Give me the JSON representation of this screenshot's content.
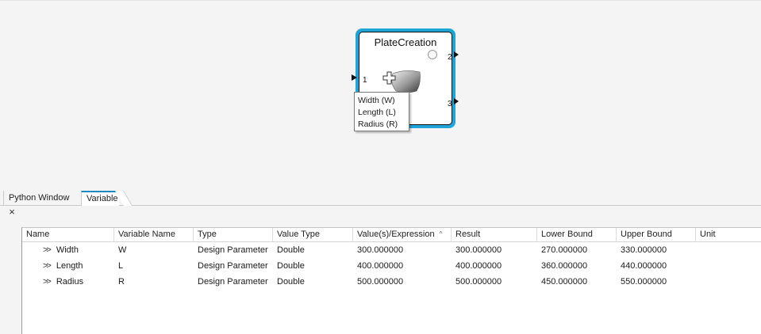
{
  "canvas": {
    "block": {
      "title": "PlateCreation",
      "input_port": "1",
      "output_port_top": "2",
      "output_port_bottom": "3",
      "accent_color": "#1fa4d8"
    },
    "tooltip": {
      "lines": [
        "Width (W)",
        "Length (L)",
        "Radius (R)"
      ]
    }
  },
  "tabs": [
    {
      "label": "Python Window",
      "active": false
    },
    {
      "label": "Variable",
      "active": true
    }
  ],
  "panel": {
    "close_icon": "×"
  },
  "table": {
    "columns": [
      "Name",
      "Variable Name",
      "Type",
      "Value Type",
      "Value(s)/Expression",
      "Result",
      "Lower Bound",
      "Upper Bound",
      "Unit"
    ],
    "sort_icon": "^",
    "expand_icon": ">>",
    "rows": [
      {
        "name": "Width",
        "var": "W",
        "type": "Design Parameter",
        "value_type": "Double",
        "expr": "300.000000",
        "result": "300.000000",
        "lower": "270.000000",
        "upper": "330.000000",
        "unit": ""
      },
      {
        "name": "Length",
        "var": "L",
        "type": "Design Parameter",
        "value_type": "Double",
        "expr": "400.000000",
        "result": "400.000000",
        "lower": "360.000000",
        "upper": "440.000000",
        "unit": ""
      },
      {
        "name": "Radius",
        "var": "R",
        "type": "Design Parameter",
        "value_type": "Double",
        "expr": "500.000000",
        "result": "500.000000",
        "lower": "450.000000",
        "upper": "550.000000",
        "unit": ""
      }
    ]
  }
}
